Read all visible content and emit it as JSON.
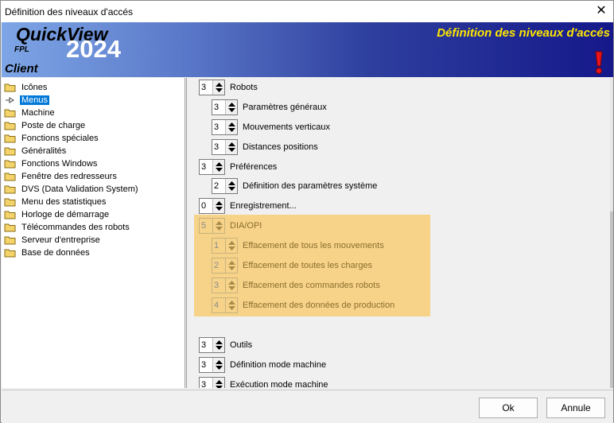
{
  "window": {
    "title": "Définition des niveaux d'accés",
    "close_glyph": "✕"
  },
  "banner": {
    "product": "QuickView",
    "fpl": "FPL",
    "year": "2024",
    "client": "Client",
    "heading": "Définition des niveaux d'accés",
    "accent": "#ffe600"
  },
  "tree": {
    "items": [
      {
        "label": "Icônes",
        "icon": "folder-icon"
      },
      {
        "label": "Menus",
        "icon": "arrow-icon",
        "selected": true
      },
      {
        "label": "Machine",
        "icon": "folder-icon"
      },
      {
        "label": "Poste de charge",
        "icon": "folder-icon"
      },
      {
        "label": "Fonctions spéciales",
        "icon": "folder-icon"
      },
      {
        "label": "Généralités",
        "icon": "folder-icon"
      },
      {
        "label": "Fonctions Windows",
        "icon": "folder-icon"
      },
      {
        "label": "Fenêtre des redresseurs",
        "icon": "folder-icon"
      },
      {
        "label": "DVS (Data Validation System)",
        "icon": "folder-icon"
      },
      {
        "label": "Menu des statistiques",
        "icon": "folder-icon"
      },
      {
        "label": "Horloge de démarrage",
        "icon": "folder-icon"
      },
      {
        "label": "Télécommandes des robots",
        "icon": "folder-icon"
      },
      {
        "label": "Serveur d'entreprise",
        "icon": "folder-icon"
      },
      {
        "label": "Base de données",
        "icon": "folder-icon"
      }
    ]
  },
  "settings": {
    "rows": [
      {
        "value": "3",
        "label": "Robots",
        "indent": 0
      },
      {
        "value": "3",
        "label": "Paramètres généraux",
        "indent": 1
      },
      {
        "value": "3",
        "label": "Mouvements verticaux",
        "indent": 1
      },
      {
        "value": "3",
        "label": "Distances positions",
        "indent": 1
      },
      {
        "value": "3",
        "label": "Préférences",
        "indent": 0
      },
      {
        "value": "2",
        "label": "Définition des paramètres système",
        "indent": 1
      },
      {
        "value": "0",
        "label": "Enregistrement...",
        "indent": 0
      },
      {
        "value": "5",
        "label": "DIA/OPI",
        "indent": 0,
        "disabled": true
      },
      {
        "value": "1",
        "label": "Effacement de tous les mouvements",
        "indent": 1,
        "disabled": true
      },
      {
        "value": "2",
        "label": "Effacement de toutes les charges",
        "indent": 1,
        "disabled": true
      },
      {
        "value": "3",
        "label": "Effacement des commandes robots",
        "indent": 1,
        "disabled": true
      },
      {
        "value": "4",
        "label": "Effacement des données de production",
        "indent": 1,
        "disabled": true
      },
      {
        "value": "3",
        "label": "Outils",
        "indent": 0
      },
      {
        "value": "3",
        "label": "Définition mode machine",
        "indent": 0
      },
      {
        "value": "3",
        "label": "Exécution mode machine",
        "indent": 0
      }
    ]
  },
  "footer": {
    "ok_label": "Ok",
    "cancel_label": "Annule"
  }
}
